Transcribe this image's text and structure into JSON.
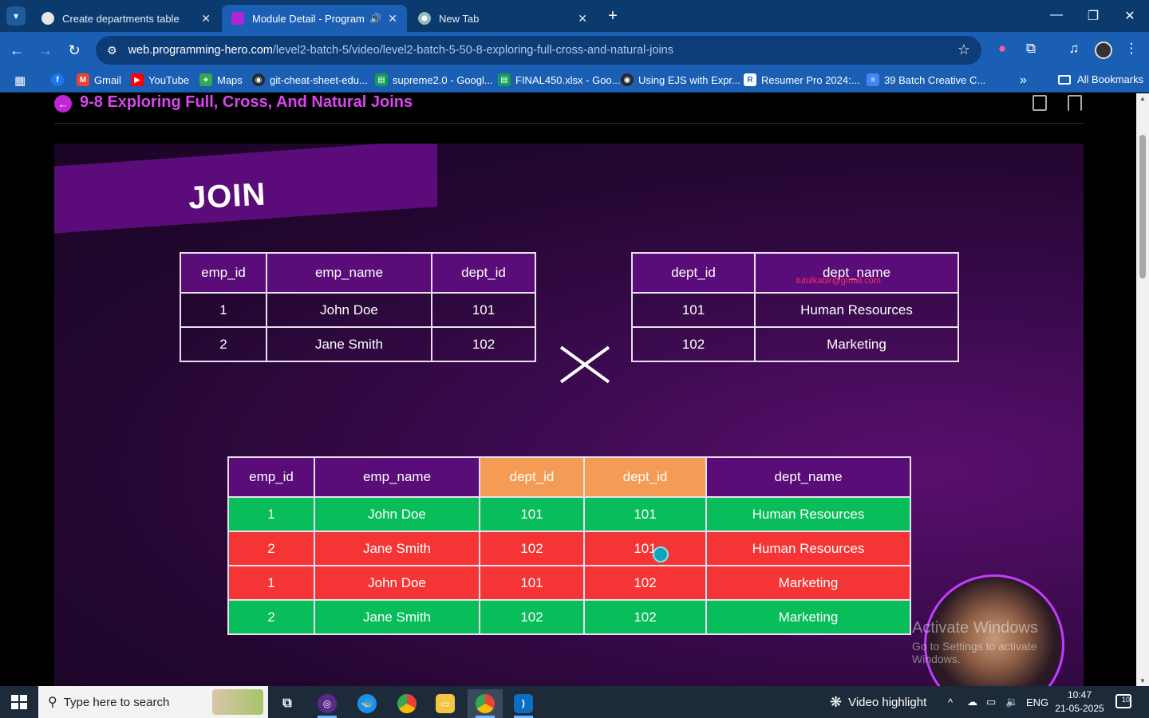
{
  "browser": {
    "tabs": [
      {
        "title": "Create departments table",
        "active": false
      },
      {
        "title": "Module Detail - Programmi",
        "active": true,
        "audio": true
      },
      {
        "title": "New Tab",
        "active": false
      }
    ],
    "url_host": "web.programming-hero.com",
    "url_path": "/level2-batch-5/video/level2-batch-5-50-8-exploring-full-cross-and-natural-joins",
    "bookmarks": [
      {
        "label": "Gmail",
        "color": "#ea4335"
      },
      {
        "label": "YouTube",
        "color": "#ff0000"
      },
      {
        "label": "Maps",
        "color": "#34a853"
      },
      {
        "label": "git-cheat-sheet-edu...",
        "color": "#24292e"
      },
      {
        "label": "supreme2.0 - Googl...",
        "color": "#0f9d58"
      },
      {
        "label": "FINAL450.xlsx - Goo...",
        "color": "#0f9d58"
      },
      {
        "label": "Using EJS with Expr...",
        "color": "#24292e"
      },
      {
        "label": "Resumer Pro 2024:...",
        "color": "#2d6cdf"
      },
      {
        "label": "39 Batch Creative C...",
        "color": "#4285f4"
      }
    ],
    "all_bookmarks": "All Bookmarks"
  },
  "lesson": {
    "title": "9-8 Exploring Full, Cross, And Natural Joins"
  },
  "slide": {
    "heading": "JOIN",
    "watermark": "tutulkabir@gmail.com",
    "employees": {
      "headers": [
        "emp_id",
        "emp_name",
        "dept_id"
      ],
      "rows": [
        [
          "1",
          "John Doe",
          "101"
        ],
        [
          "2",
          "Jane Smith",
          "102"
        ]
      ]
    },
    "departments": {
      "headers": [
        "dept_id",
        "dept_name"
      ],
      "rows": [
        [
          "101",
          "Human Resources"
        ],
        [
          "102",
          "Marketing"
        ]
      ]
    },
    "result": {
      "headers": [
        "emp_id",
        "emp_name",
        "dept_id",
        "dept_id",
        "dept_name"
      ],
      "rows": [
        {
          "status": "match",
          "cells": [
            "1",
            "John Doe",
            "101",
            "101",
            "Human Resources"
          ]
        },
        {
          "status": "mismatch",
          "cells": [
            "2",
            "Jane Smith",
            "102",
            "101",
            "Human Resources"
          ]
        },
        {
          "status": "mismatch",
          "cells": [
            "1",
            "John Doe",
            "101",
            "102",
            "Marketing"
          ]
        },
        {
          "status": "match",
          "cells": [
            "2",
            "Jane Smith",
            "102",
            "102",
            "Marketing"
          ]
        }
      ]
    },
    "colors": {
      "match": "#08bd5a",
      "mismatch": "#f53535",
      "key_header": "#f49c56",
      "header": "#5a0c78"
    }
  },
  "windows_overlay": {
    "line1": "Activate Windows",
    "line2": "Go to Settings to activate Windows."
  },
  "taskbar": {
    "search_placeholder": "Type here to search",
    "video_highlight": "Video highlight",
    "language": "ENG",
    "time": "10:47",
    "date": "21-05-2025",
    "notifications": "10"
  }
}
